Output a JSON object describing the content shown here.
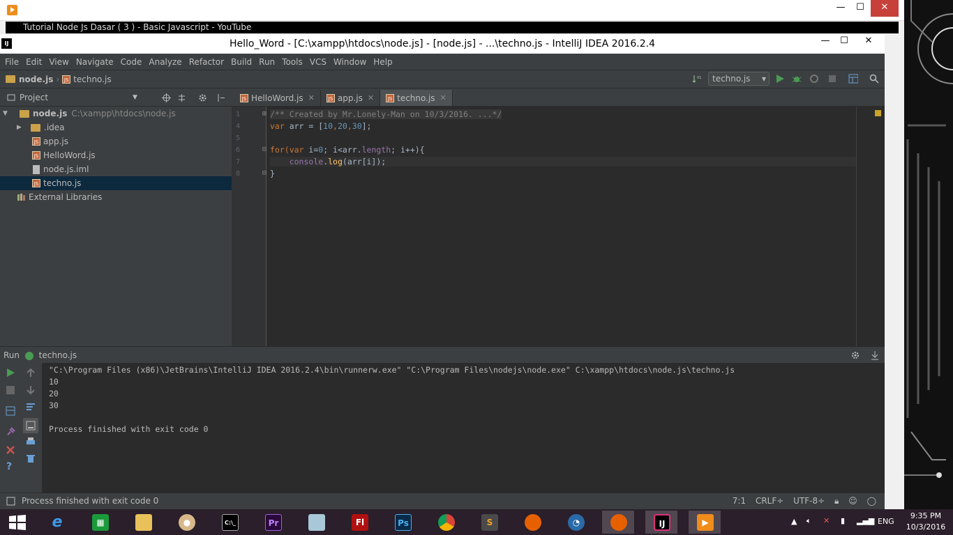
{
  "outer_window": {
    "youtube_title": "Tutorial Node Js Dasar ( 3 ) - Basic Javascript - YouTube"
  },
  "window": {
    "title": "Hello_Word - [C:\\xampp\\htdocs\\node.js] - [node.js] - ...\\techno.js - IntelliJ IDEA 2016.2.4",
    "logo": "IJ",
    "min": "—",
    "max": "☐",
    "close": "✕"
  },
  "menu": [
    "File",
    "Edit",
    "View",
    "Navigate",
    "Code",
    "Analyze",
    "Refactor",
    "Build",
    "Run",
    "Tools",
    "VCS",
    "Window",
    "Help"
  ],
  "breadcrumb": {
    "project": "node.js",
    "file": "techno.js"
  },
  "run_config": "techno.js",
  "project_panel": {
    "header": "Project",
    "root": {
      "name": "node.js",
      "path": "C:\\xampp\\htdocs\\node.js"
    },
    "items": [
      ".idea",
      "app.js",
      "HelloWord.js",
      "node.js.iml",
      "techno.js"
    ],
    "external": "External Libraries"
  },
  "tabs": [
    "HelloWord.js",
    "app.js",
    "techno.js"
  ],
  "code": {
    "line_numbers": [
      "1",
      "4",
      "5",
      "6",
      "7",
      "8"
    ],
    "comment": "/** Created by Mr.Lonely-Man on 10/3/2016. ...*/",
    "l4_kw": "var",
    "l4_a": " arr = [",
    "l4_n1": "10",
    "l4_n2": "20",
    "l4_n3": "30",
    "l4_end": "];",
    "l6_a": "for(",
    "l6_kw": "var",
    "l6_b": " i=",
    "l6_n": "0",
    "l6_c": "; i<arr.",
    "l6_prop": "length",
    "l6_d": "; i++){",
    "l7_a": "    ",
    "l7_prop": "console",
    "l7_dot": ".",
    "l7_fn": "log",
    "l7_rest": "(arr[i]);",
    "l8": "}"
  },
  "run_panel": {
    "label": "Run",
    "config": "techno.js"
  },
  "console": {
    "command": "\"C:\\Program Files (x86)\\JetBrains\\IntelliJ IDEA 2016.2.4\\bin\\runnerw.exe\" \"C:\\Program Files\\nodejs\\node.exe\" C:\\xampp\\htdocs\\node.js\\techno.js",
    "outputs": [
      "10",
      "20",
      "30"
    ],
    "exit": "Process finished with exit code 0"
  },
  "status": {
    "message": "Process finished with exit code 0",
    "position": "7:1",
    "line_sep": "CRLF÷",
    "encoding": "UTF-8÷"
  },
  "taskbar": {
    "lang": "ENG",
    "time": "9:35 PM",
    "date": "10/3/2016",
    "pr": "Pr",
    "fl": "Fl",
    "ps": "Ps",
    "ij": "IJ",
    "s": "S"
  }
}
